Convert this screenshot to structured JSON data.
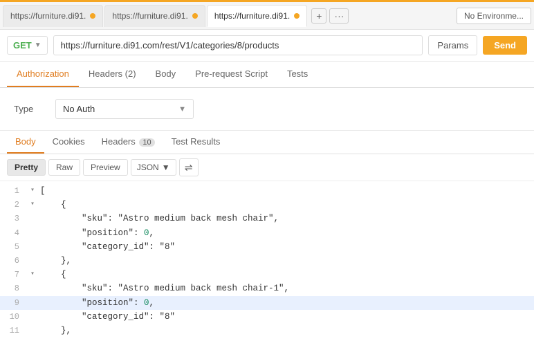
{
  "topBorder": true,
  "tabs": [
    {
      "id": "tab1",
      "label": "https://furniture.di91.",
      "active": false,
      "hasDot": true
    },
    {
      "id": "tab2",
      "label": "https://furniture.di91.",
      "active": false,
      "hasDot": true
    },
    {
      "id": "tab3",
      "label": "https://furniture.di91.",
      "active": true,
      "hasDot": true
    }
  ],
  "tabActions": {
    "add": "+",
    "more": "···"
  },
  "environment": {
    "label": "No Environme..."
  },
  "requestBar": {
    "method": "GET",
    "url": "https://furniture.di91.com/rest/V1/categories/8/products",
    "paramsLabel": "Params",
    "sendLabel": "Send"
  },
  "requestTabs": [
    {
      "id": "authorization",
      "label": "Authorization",
      "active": true
    },
    {
      "id": "headers",
      "label": "Headers (2)",
      "active": false
    },
    {
      "id": "body",
      "label": "Body",
      "active": false
    },
    {
      "id": "prerequest",
      "label": "Pre-request Script",
      "active": false
    },
    {
      "id": "tests",
      "label": "Tests",
      "active": false
    }
  ],
  "auth": {
    "typeLabel": "Type",
    "selectedAuth": "No Auth"
  },
  "responseTabs": [
    {
      "id": "body",
      "label": "Body",
      "active": true,
      "badge": null
    },
    {
      "id": "cookies",
      "label": "Cookies",
      "active": false,
      "badge": null
    },
    {
      "id": "headers",
      "label": "Headers",
      "active": false,
      "badge": "10"
    },
    {
      "id": "testresults",
      "label": "Test Results",
      "active": false,
      "badge": null
    }
  ],
  "codeToolbar": {
    "prettyLabel": "Pretty",
    "rawLabel": "Raw",
    "previewLabel": "Preview",
    "format": "JSON",
    "wrapIcon": "⇌"
  },
  "jsonLines": [
    {
      "num": 1,
      "toggle": "▾",
      "content": "[",
      "highlight": false
    },
    {
      "num": 2,
      "toggle": "▾",
      "content": "    {",
      "highlight": false
    },
    {
      "num": 3,
      "toggle": null,
      "content": "        \"sku\": \"Astro medium back mesh chair\",",
      "highlight": false
    },
    {
      "num": 4,
      "toggle": null,
      "content": "        \"position\": 0,",
      "highlight": false
    },
    {
      "num": 5,
      "toggle": null,
      "content": "        \"category_id\": \"8\"",
      "highlight": false
    },
    {
      "num": 6,
      "toggle": null,
      "content": "    },",
      "highlight": false
    },
    {
      "num": 7,
      "toggle": "▾",
      "content": "    {",
      "highlight": false
    },
    {
      "num": 8,
      "toggle": null,
      "content": "        \"sku\": \"Astro medium back mesh chair-1\",",
      "highlight": false
    },
    {
      "num": 9,
      "toggle": null,
      "content": "        \"position\": 0,",
      "highlight": true
    },
    {
      "num": 10,
      "toggle": null,
      "content": "        \"category_id\": \"8\"",
      "highlight": false
    },
    {
      "num": 11,
      "toggle": null,
      "content": "    },",
      "highlight": false
    }
  ]
}
